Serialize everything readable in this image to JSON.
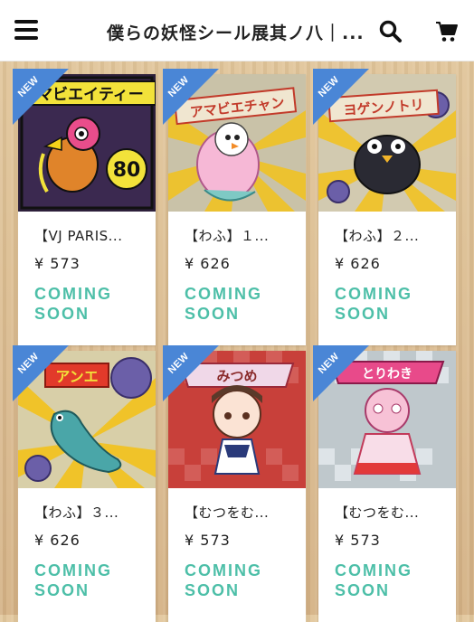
{
  "header": {
    "title": "僕らの妖怪シール展其ノ八｜...",
    "icons": [
      "menu-icon",
      "search-icon",
      "cart-icon"
    ]
  },
  "badge_label": "NEW",
  "colors": {
    "badge": "#4a86d6",
    "status": "#4dbfa8"
  },
  "products": [
    {
      "name": "【VJ PARIS...",
      "price": "¥ 573",
      "status": "COMING SOON",
      "sticker_title": "マビエイティー",
      "sticker_number": "80"
    },
    {
      "name": "【わふ】１...",
      "price": "¥ 626",
      "status": "COMING SOON",
      "sticker_title": "アマビエチャン"
    },
    {
      "name": "【わふ】２...",
      "price": "¥ 626",
      "status": "COMING SOON",
      "sticker_title": "ヨゲンノトリ"
    },
    {
      "name": "【わふ】３...",
      "price": "¥ 626",
      "status": "COMING SOON",
      "sticker_title": "アンエ"
    },
    {
      "name": "【むつをむ...",
      "price": "¥ 573",
      "status": "COMING SOON",
      "sticker_title": "みつめ"
    },
    {
      "name": "【むつをむ...",
      "price": "¥ 573",
      "status": "COMING SOON",
      "sticker_title": "とりわき"
    }
  ]
}
